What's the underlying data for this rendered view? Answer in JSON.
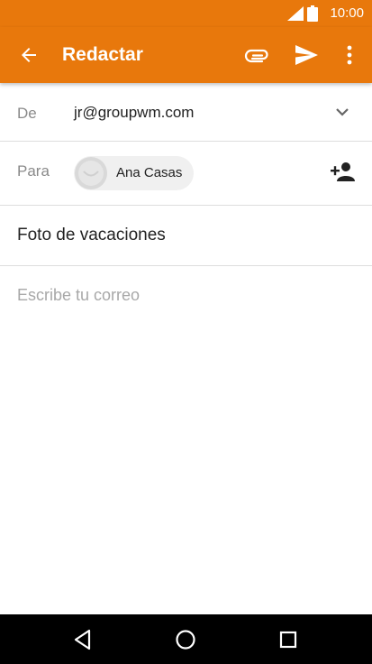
{
  "status_bar": {
    "time": "10:00",
    "icons": [
      "signal-icon",
      "battery-icon"
    ]
  },
  "app_bar": {
    "title": "Redactar",
    "icons": [
      "back-arrow-icon",
      "paperclip-icon",
      "send-icon",
      "more-vert-icon"
    ]
  },
  "compose": {
    "from_label": "De",
    "from_value": "jr@groupwm.com",
    "to_label": "Para",
    "recipient": "Ana Casas",
    "subject": "Foto de vacaciones",
    "body_placeholder": "Escribe tu correo"
  },
  "nav_bar": {
    "icons": [
      "nav-back-icon",
      "nav-home-icon",
      "nav-recents-icon"
    ]
  },
  "colors": {
    "accent": "#e8780c",
    "text": "#222222",
    "label": "#8a8a8a",
    "placeholder": "#a8a8a8",
    "divider": "#dddddd"
  }
}
